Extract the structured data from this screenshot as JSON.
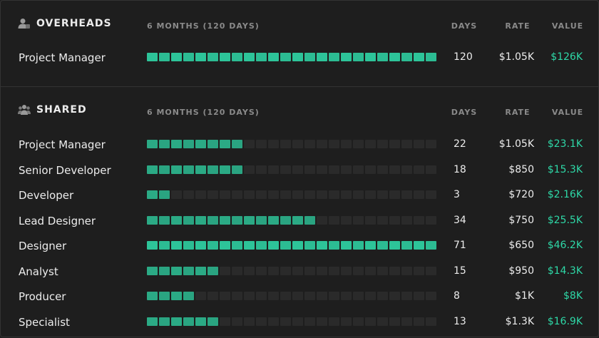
{
  "colors": {
    "accent": "#2ed8a7",
    "bar_full": "#2fd6a6",
    "bar_empty": "#2a2a2a"
  },
  "overheads": {
    "title": "OVERHEADS",
    "icon": "user-icon",
    "period": "6 MONTHS (120 DAYS)",
    "columns": {
      "days": "DAYS",
      "rate": "RATE",
      "value": "VALUE"
    },
    "rows": [
      {
        "label": "Project Manager",
        "days": "120",
        "rate": "$1.05K",
        "value": "$126K",
        "filled": 24
      }
    ]
  },
  "shared": {
    "title": "SHARED",
    "icon": "team-icon",
    "period": "6 MONTHS (120 DAYS)",
    "columns": {
      "days": "DAYS",
      "rate": "RATE",
      "value": "VALUE"
    },
    "rows": [
      {
        "label": "Project Manager",
        "days": "22",
        "rate": "$1.05K",
        "value": "$23.1K",
        "filled": 8
      },
      {
        "label": "Senior Developer",
        "days": "18",
        "rate": "$850",
        "value": "$15.3K",
        "filled": 8
      },
      {
        "label": "Developer",
        "days": "3",
        "rate": "$720",
        "value": "$2.16K",
        "filled": 2
      },
      {
        "label": "Lead Designer",
        "days": "34",
        "rate": "$750",
        "value": "$25.5K",
        "filled": 14
      },
      {
        "label": "Designer",
        "days": "71",
        "rate": "$650",
        "value": "$46.2K",
        "filled": 24
      },
      {
        "label": "Analyst",
        "days": "15",
        "rate": "$950",
        "value": "$14.3K",
        "filled": 6
      },
      {
        "label": "Producer",
        "days": "8",
        "rate": "$1K",
        "value": "$8K",
        "filled": 4
      },
      {
        "label": "Specialist",
        "days": "13",
        "rate": "$1.3K",
        "value": "$16.9K",
        "filled": 6
      }
    ]
  },
  "bar_segments": 24
}
